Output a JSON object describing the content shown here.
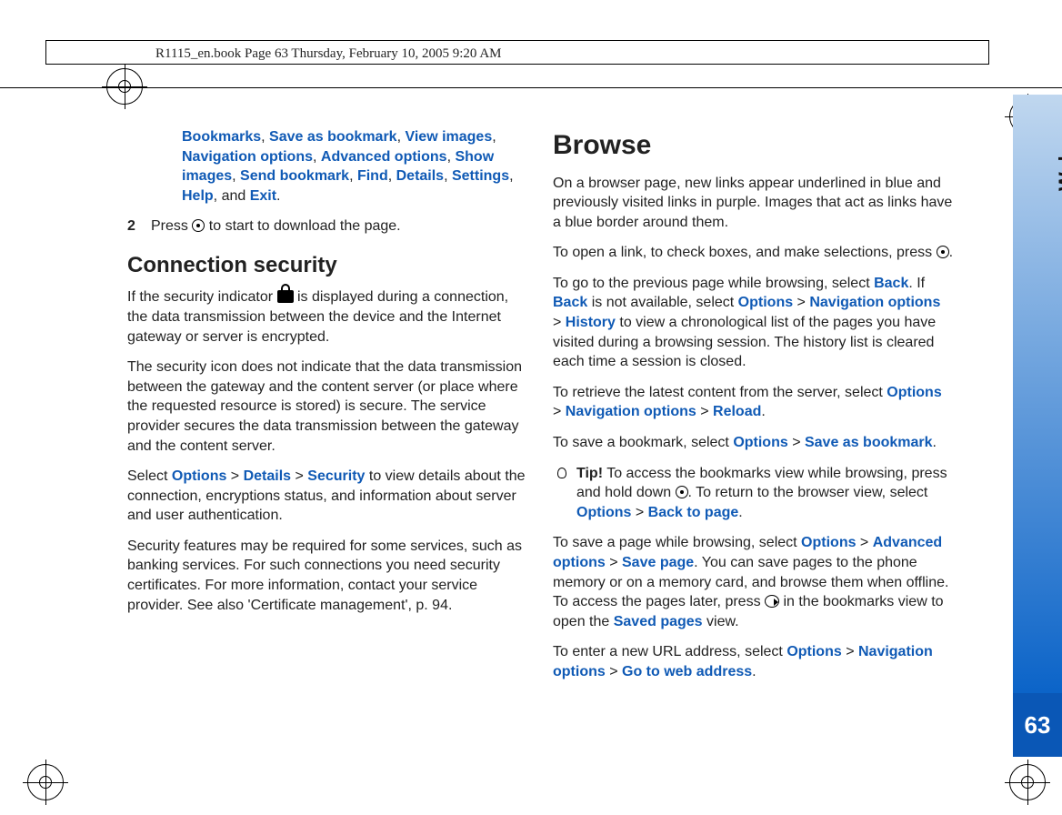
{
  "header": {
    "text": "R1115_en.book  Page 63  Thursday, February 10, 2005  9:20 AM"
  },
  "tab": {
    "label": "Web",
    "page": "63"
  },
  "left": {
    "options_continuation": {
      "items": [
        "Bookmarks",
        "Save as bookmark",
        "View images",
        "Navigation options",
        "Advanced options",
        "Show images",
        "Send bookmark",
        "Find",
        "Details",
        "Settings",
        "Help",
        "Exit"
      ],
      "sep": ", ",
      "and": ", and "
    },
    "step2": {
      "num": "2",
      "pre": "Press ",
      "post": " to start to download the page."
    },
    "conn_heading": "Connection security",
    "para1": {
      "pre": "If the security indicator ",
      "post": " is displayed during a connection, the data transmission between the device and the Internet gateway or server is encrypted."
    },
    "para2": "The security icon does not indicate that the data transmission between the gateway and the content server (or place where the requested resource is stored) is secure. The service provider secures the data transmission between the gateway and the content server.",
    "para3": {
      "pre": "Select ",
      "o": "Options",
      "d": "Details",
      "s": "Security",
      "post": " to view details about the connection, encryptions status, and information about server and user authentication."
    },
    "para4": "Security features may be required for some services, such as banking services. For such connections you need security certificates. For more information, contact your service provider. See also 'Certificate management', p. 94."
  },
  "right": {
    "heading": "Browse",
    "p1": "On a browser page, new links appear underlined in blue and previously visited links in purple. Images that act as links have a blue border around them.",
    "p2": {
      "pre": "To open a link, to check boxes, and make selections, press ",
      "post": "."
    },
    "p3": {
      "pre": "To go to the previous page while browsing, select ",
      "back": "Back",
      "mid1": ". If ",
      "mid2": " is not available, select ",
      "options": "Options",
      "nav": "Navigation options",
      "history": "History",
      "post": " to view a chronological list of the pages you have visited during a browsing session. The history list is cleared each time a session is closed."
    },
    "p4": {
      "pre": "To retrieve the latest content from the server, select ",
      "options": "Options",
      "nav": "Navigation options",
      "reload": "Reload",
      "post": "."
    },
    "p5": {
      "pre": "To save a bookmark, select ",
      "options": "Options",
      "save": "Save as bookmark",
      "post": "."
    },
    "tip": {
      "label": "Tip!",
      "pre": " To access the bookmarks view while browsing, press and hold down ",
      "mid": ". To return to the browser view, select ",
      "options": "Options",
      "back": "Back to page",
      "post": "."
    },
    "p6": {
      "pre": "To save a page while browsing, select ",
      "options": "Options",
      "adv": "Advanced options",
      "save": "Save page",
      "mid": ". You can save pages to the phone memory or on a memory card, and browse them when offline. To access the pages later, press ",
      "mid2": " in the bookmarks view to open the ",
      "saved": "Saved pages",
      "post": " view."
    },
    "p7": {
      "pre": "To enter a new URL address, select ",
      "options": "Options",
      "nav": "Navigation options",
      "go": "Go to web address",
      "post": "."
    }
  }
}
